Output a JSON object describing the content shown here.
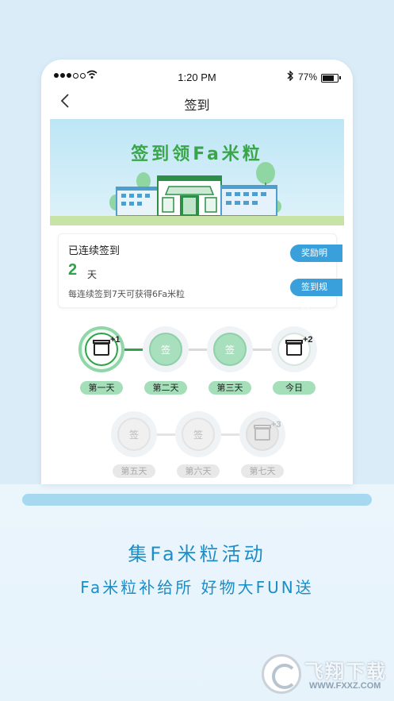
{
  "status_bar": {
    "time": "1:20 PM",
    "battery_pct": "77%",
    "battery_level": 0.77
  },
  "nav": {
    "title": "签到"
  },
  "banner": {
    "title": "签到领Fa米粒"
  },
  "info": {
    "heading": "已连续签到",
    "days": "2",
    "unit": "天",
    "note": "每连续签到7天可获得6Fa米粒",
    "btn_reward": "奖励明细",
    "btn_rules": "签到规则"
  },
  "days": {
    "d1": {
      "label": "第一天",
      "bonus": "+1"
    },
    "d2": {
      "label": "第二天",
      "stamp": "签"
    },
    "d3": {
      "label": "第三天",
      "stamp": "签"
    },
    "d4": {
      "label": "今日",
      "bonus": "+2"
    },
    "d5": {
      "label": "第五天",
      "stamp": "签"
    },
    "d6": {
      "label": "第六天",
      "stamp": "签"
    },
    "d7": {
      "label": "第七天",
      "bonus": "+3"
    }
  },
  "promo": {
    "headline": "集Fa米粒活动",
    "subline": "Fa米粒补给所 好物大FUN送"
  },
  "watermark": {
    "text": "飞翔下载",
    "url": "WWW.FXXZ.COM"
  },
  "colors": {
    "accent_green": "#2fa34a",
    "accent_blue": "#3aa0dc",
    "promo_text": "#1b8dc7"
  }
}
